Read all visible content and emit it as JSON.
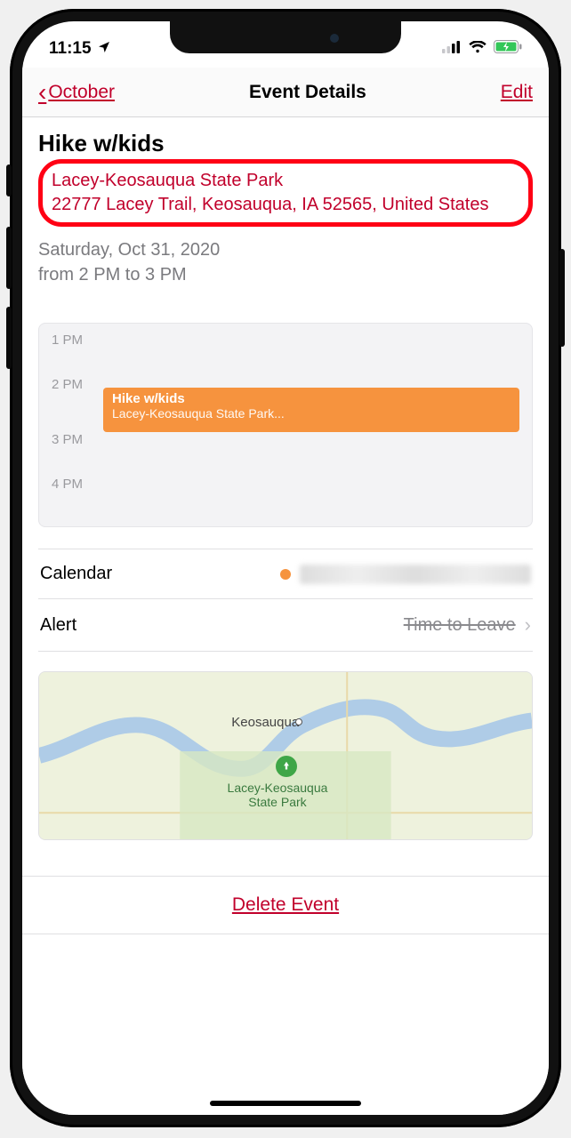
{
  "status": {
    "time": "11:15",
    "location_icon": "location-arrow"
  },
  "nav": {
    "back_label": "October",
    "title": "Event Details",
    "edit_label": "Edit"
  },
  "event": {
    "title": "Hike w/kids",
    "location_name": "Lacey-Keosauqua State Park",
    "location_address": "22777 Lacey Trail, Keosauqua, IA  52565, United States",
    "date_line": "Saturday, Oct 31, 2020",
    "time_line": "from 2 PM to 3 PM"
  },
  "timeline": {
    "hours": [
      "1 PM",
      "2 PM",
      "3 PM",
      "4 PM"
    ],
    "block_title": "Hike w/kids",
    "block_location": "Lacey-Keosauqua State Park..."
  },
  "rows": {
    "calendar_label": "Calendar",
    "alert_label": "Alert",
    "alert_value": "Time to Leave"
  },
  "map": {
    "city_label": "Keosauqua",
    "park_label_line1": "Lacey-Keosauqua",
    "park_label_line2": "State Park"
  },
  "delete_label": "Delete Event"
}
